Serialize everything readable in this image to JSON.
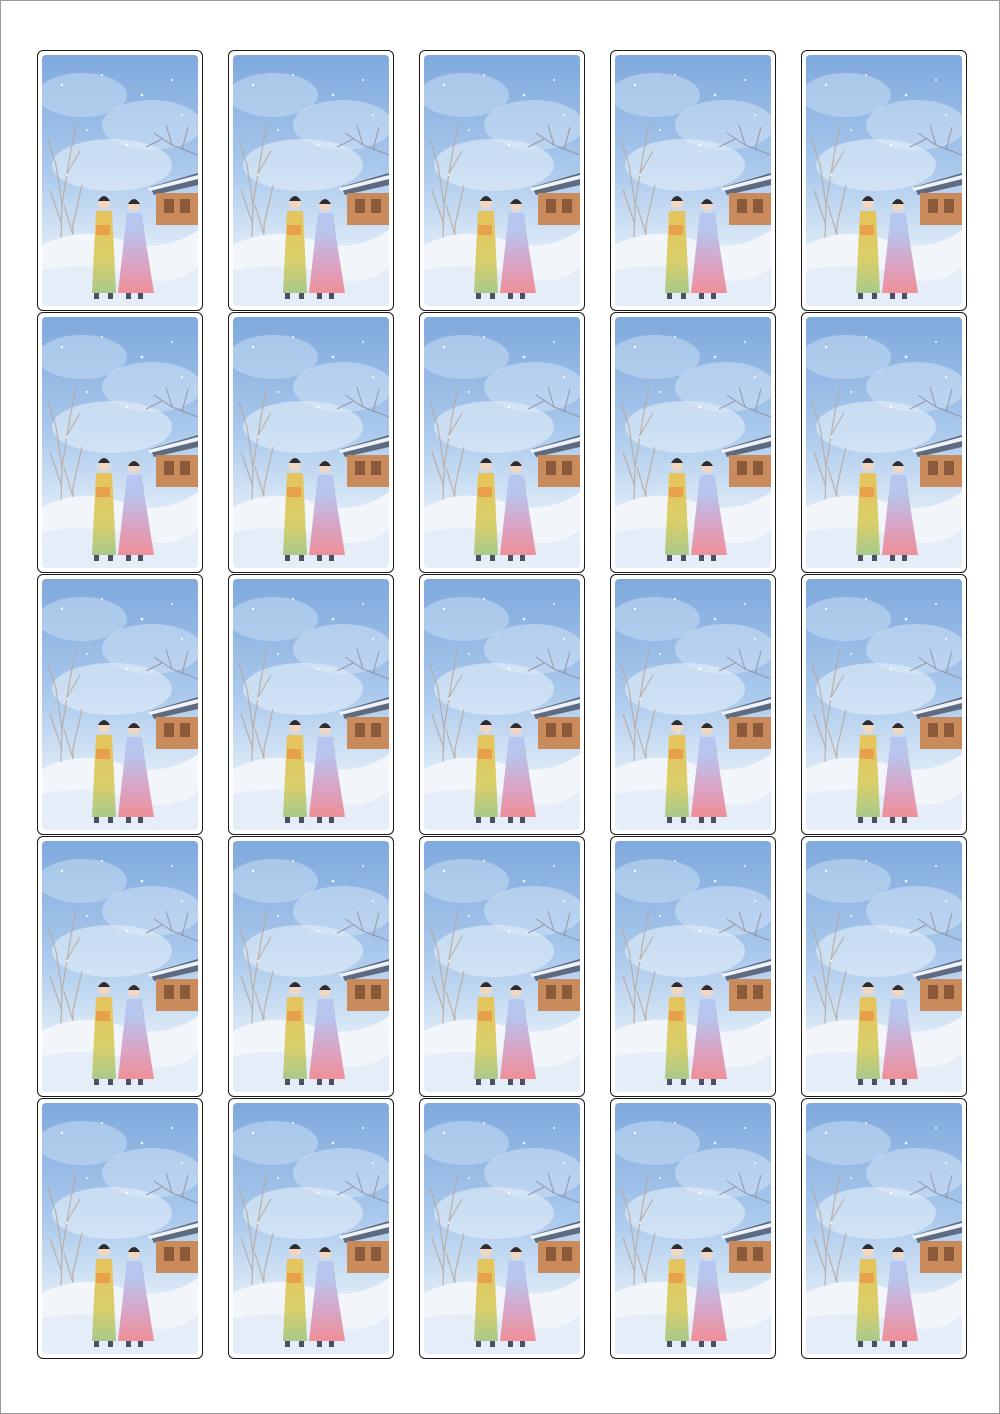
{
  "sheet": {
    "rows": 5,
    "columns": 5,
    "card_count": 25,
    "border_color": "#1a1a1a"
  },
  "illustration": {
    "subject": "watercolor-couple-in-hanbok-winter",
    "sky_colors": [
      "#7fa9dd",
      "#a9c8ec",
      "#d9e8f6"
    ],
    "snow_color": "#f2f6fb",
    "man_robe_color": "#e7c35a",
    "woman_skirt_color": "#ef8f97",
    "woman_jacket_color": "#b6c6ee",
    "house_wall_color": "#c98b5c",
    "roof_color": "#5d6a80"
  }
}
